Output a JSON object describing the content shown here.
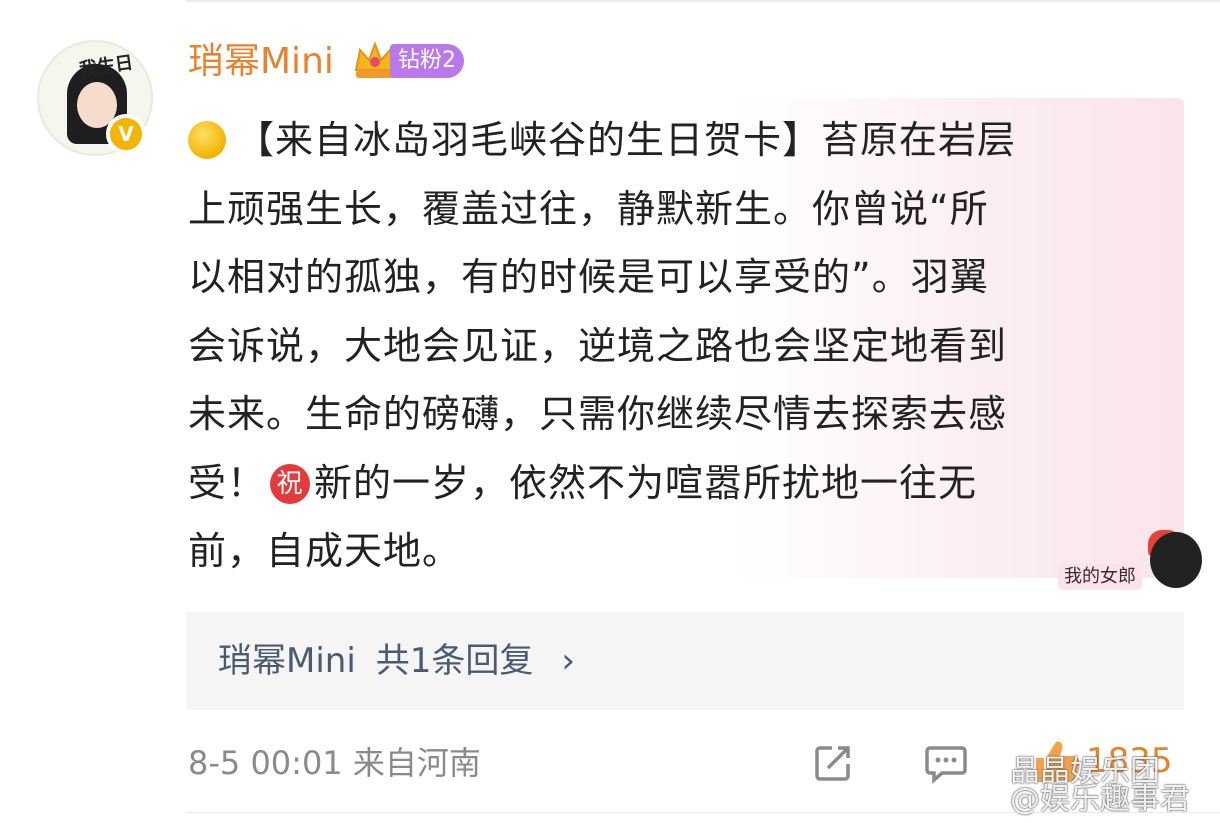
{
  "post": {
    "username": "琑幂Mini",
    "fan_badge": "钻粉2",
    "avatar_text": "我生日",
    "verified_mark": "V",
    "content": {
      "line1_main": "【来自冰岛羽毛峡谷的生日贺卡】苔原在岩层",
      "line2": "上顽强生长，覆盖过往，静默新生。你曾说“所",
      "line3": "以相对的孤独，有的时候是可以享受的”。羽翼",
      "line4": "会诉说，大地会见证，逆境之路也会坚定地看到",
      "line5": "未来。生命的磅礴，只需你继续尽情去探索去感",
      "line6_start": "受！",
      "zhu_emoji": "祝",
      "line6_end": "新的一岁，依然不为喧嚣所扰地一往无",
      "line7": "前，自成天地。"
    },
    "sticker_label": "我的女郎",
    "reply": {
      "author": "琑幂Mini",
      "count_text": "共1条回复",
      "chevron": "›"
    },
    "meta": {
      "time": "8-5 00:01",
      "location": "来自河南"
    },
    "like_count": "1835"
  },
  "watermark": {
    "line1": "晶晶娱乐团",
    "line2": "@娱乐趣事君"
  },
  "colors": {
    "username": "#e9822a",
    "badge": "#b979ea",
    "reply_text": "#4a5a73",
    "meta": "#8a8a8a"
  },
  "icons": [
    "share-icon",
    "comment-icon",
    "like-icon",
    "crown-icon",
    "verified-icon",
    "coin-emoji-icon",
    "zhu-emoji-icon",
    "weibo-logo-icon"
  ]
}
